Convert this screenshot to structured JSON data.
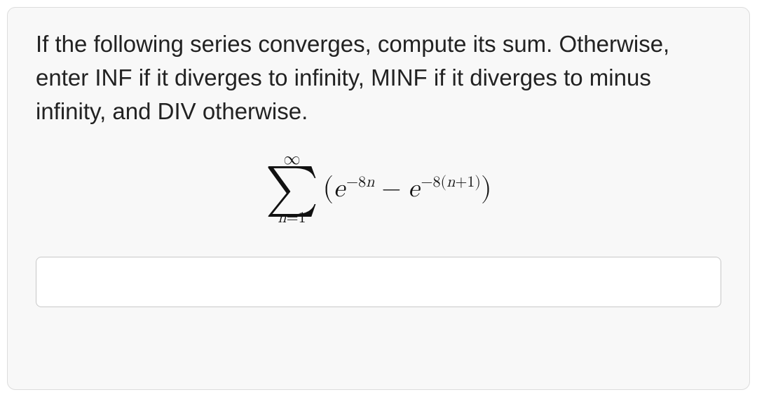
{
  "question": {
    "prompt": "If the following series converges, compute its sum. Otherwise, enter INF if it diverges to infinity, MINF if it diverges to minus infinity, and DIV otherwise."
  },
  "formula": {
    "sigma_top": "∞",
    "sigma_symbol": "∑",
    "sigma_bottom_lhs": "n",
    "sigma_bottom_eq": "=",
    "sigma_bottom_rhs": "1",
    "lparen": "(",
    "base1": "e",
    "exp1_minus": "−8",
    "exp1_var": "n",
    "minus": "−",
    "base2": "e",
    "exp2_minus": "−8(",
    "exp2_var": "n",
    "exp2_plus": "+1)",
    "rparen": ")"
  },
  "answer": {
    "value": "",
    "placeholder": ""
  }
}
